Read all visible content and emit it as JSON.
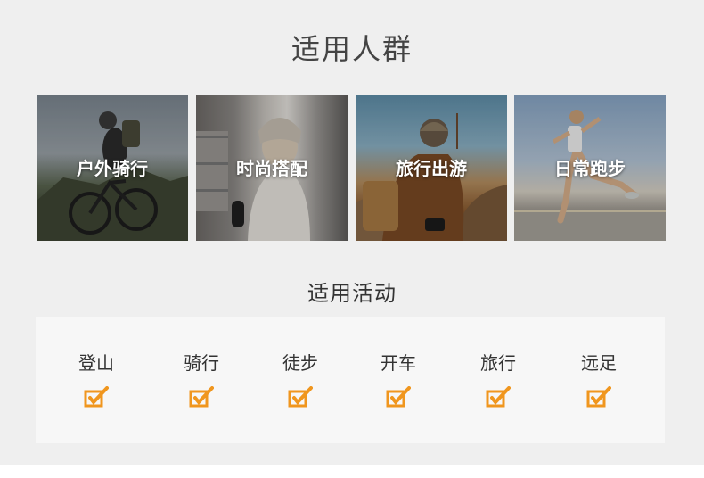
{
  "heading": "适用人群",
  "people": [
    {
      "label": "户外骑行",
      "image": "cyclist-mountain-photo"
    },
    {
      "label": "时尚搭配",
      "image": "woman-beanie-fashion-photo"
    },
    {
      "label": "旅行出游",
      "image": "traveler-backpack-photo"
    },
    {
      "label": "日常跑步",
      "image": "runner-road-photo"
    }
  ],
  "activities_heading": "适用活动",
  "activities": [
    {
      "label": "登山",
      "icon": "check-icon"
    },
    {
      "label": "骑行",
      "icon": "check-icon"
    },
    {
      "label": "徒步",
      "icon": "check-icon"
    },
    {
      "label": "开车",
      "icon": "check-icon"
    },
    {
      "label": "旅行",
      "icon": "check-icon"
    },
    {
      "label": "远足",
      "icon": "check-icon"
    }
  ],
  "colors": {
    "background": "#efefef",
    "check": "#f0961e",
    "text": "#333333"
  }
}
